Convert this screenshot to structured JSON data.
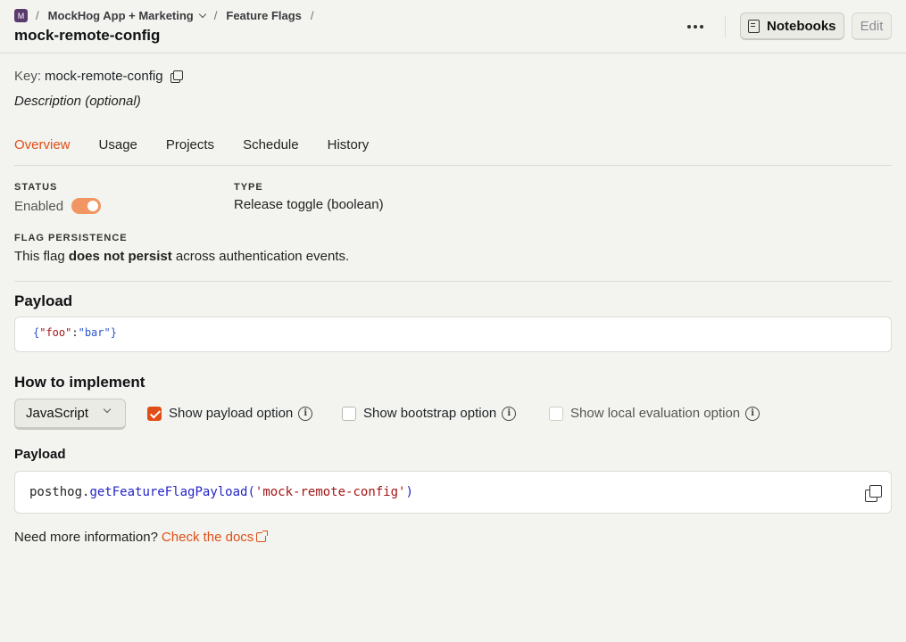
{
  "breadcrumbs": {
    "org_badge": "M",
    "separator": "/",
    "project": "MockHog App + Marketing",
    "section": "Feature Flags"
  },
  "page_title": "mock-remote-config",
  "header": {
    "notebooks_label": "Notebooks",
    "edit_label": "Edit"
  },
  "flag": {
    "key_label": "Key:",
    "key_value": "mock-remote-config",
    "description": "Description (optional)"
  },
  "tabs": [
    {
      "label": "Overview",
      "active": true
    },
    {
      "label": "Usage",
      "active": false
    },
    {
      "label": "Projects",
      "active": false
    },
    {
      "label": "Schedule",
      "active": false
    },
    {
      "label": "History",
      "active": false
    }
  ],
  "status": {
    "label": "STATUS",
    "value": "Enabled",
    "enabled": true
  },
  "type": {
    "label": "TYPE",
    "value": "Release toggle (boolean)"
  },
  "persistence": {
    "label": "FLAG PERSISTENCE",
    "prefix": "This flag ",
    "emphasis": "does not persist",
    "suffix": " across authentication events."
  },
  "payload": {
    "heading": "Payload",
    "open_brace": "{",
    "key": "\"foo\"",
    "colon": ":",
    "value": "\"bar\"",
    "close_brace": "}"
  },
  "implement": {
    "heading": "How to implement",
    "language": "JavaScript",
    "options": [
      {
        "label": "Show payload option",
        "checked": true
      },
      {
        "label": "Show bootstrap option",
        "checked": false
      },
      {
        "label": "Show local evaluation option",
        "checked": false,
        "disabled": true
      }
    ],
    "code_heading": "Payload",
    "code": {
      "object": "posthog",
      "dot": ".",
      "method": "getFeatureFlagPayload(",
      "arg": "'mock-remote-config'",
      "close": ")"
    }
  },
  "footer": {
    "question": "Need more information?",
    "link": "Check the docs"
  },
  "colors": {
    "accent": "#e04e17",
    "toggle_on": "#f19562"
  },
  "icons": [
    "dots-icon",
    "notebook-icon",
    "copy-icon",
    "info-icon",
    "chevron-down-icon",
    "external-link-icon"
  ]
}
